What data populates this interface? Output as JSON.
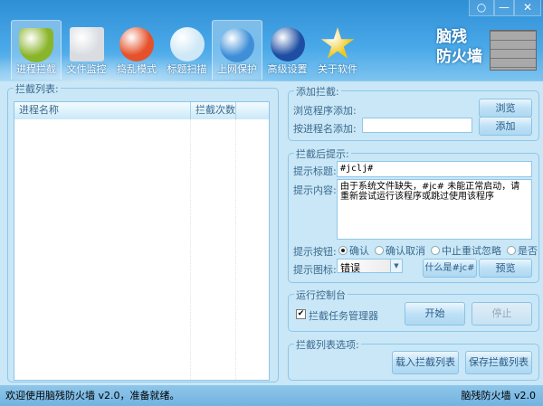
{
  "window": {
    "feedback_icon": "speech-bubble",
    "minimize": "—",
    "close": "✕"
  },
  "tabs": [
    {
      "label": "进程拦截",
      "icon": "shield",
      "color": "#8ab52a"
    },
    {
      "label": "文件监控",
      "icon": "documents",
      "color": "#d9dde2"
    },
    {
      "label": "捣乱模式",
      "icon": "prohibited",
      "color": "#e5512a"
    },
    {
      "label": "标题扫描",
      "icon": "magnifier",
      "color": "#cfe8f7"
    },
    {
      "label": "上网保护",
      "icon": "globe",
      "color": "#3f8fd8"
    },
    {
      "label": "高级设置",
      "icon": "key",
      "color": "#1e4ea3"
    },
    {
      "label": "关于软件",
      "icon": "star",
      "color": "#f2c81e"
    }
  ],
  "logo": {
    "line1": "脑残",
    "line2": "防火墙"
  },
  "block_list": {
    "legend": "拦截列表:",
    "columns": [
      "进程名称",
      "拦截次数"
    ],
    "rows": []
  },
  "add_block": {
    "legend": "添加拦截:",
    "browse_label": "浏览程序添加:",
    "browse_button": "浏览",
    "name_label": "按进程名添加:",
    "name_value": "",
    "add_button": "添加"
  },
  "prompt": {
    "legend": "拦截后提示:",
    "title_label": "提示标题:",
    "title_value": "#jclj#",
    "content_label": "提示内容:",
    "content_value": "由于系统文件缺失，#jc# 未能正常启动，请重新尝试运行该程序或跳过使用该程序",
    "buttons_label": "提示按钮:",
    "button_options": [
      "确认",
      "确认取消",
      "中止重试忽略",
      "是否"
    ],
    "selected_button": "确认",
    "icon_label": "提示图标:",
    "icon_value": "错误",
    "what_button": "什么是#jc#",
    "preview_button": "预览"
  },
  "console": {
    "legend": "运行控制台",
    "taskmgr_label": "拦截任务管理器",
    "taskmgr_checked": true,
    "start_button": "开始",
    "stop_button": "停止"
  },
  "list_options": {
    "legend": "拦截列表选项:",
    "load_button": "载入拦截列表",
    "save_button": "保存拦截列表"
  },
  "status": {
    "left": "欢迎使用脑残防火墙 v2.0，准备就绪。",
    "right": "脑残防火墙 v2.0"
  }
}
